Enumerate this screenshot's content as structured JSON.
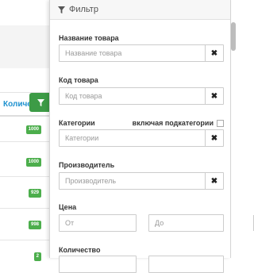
{
  "background": {
    "column_header": "Количес",
    "quantities": [
      "1000",
      "1000",
      "929",
      "998",
      "2"
    ]
  },
  "filter": {
    "title": "Фильтр",
    "fields": {
      "product_name": {
        "label": "Название товара",
        "placeholder": "Название товара",
        "clear": "✖"
      },
      "product_code": {
        "label": "Код товара",
        "placeholder": "Код товара",
        "clear": "✖"
      },
      "categories": {
        "label": "Категории",
        "subcategories_label": "включая подкатегории",
        "placeholder": "Категории",
        "clear": "✖"
      },
      "manufacturer": {
        "label": "Производитель",
        "placeholder": "Производитель",
        "clear": "✖"
      },
      "price": {
        "label": "Цена",
        "from_placeholder": "От",
        "to_placeholder": "До",
        "clear": "✖"
      },
      "quantity": {
        "label": "Количество"
      }
    }
  },
  "colors": {
    "accent_blue": "#1e91cf",
    "badge_green": "#4cae4c",
    "button_green": "#3d9b46"
  }
}
